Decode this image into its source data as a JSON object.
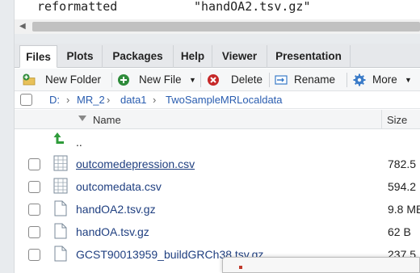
{
  "environment": {
    "row_name": "reformatted",
    "row_value": "\"handOA2.tsv.gz\""
  },
  "tabs": [
    {
      "label": "Files"
    },
    {
      "label": "Plots"
    },
    {
      "label": "Packages"
    },
    {
      "label": "Help"
    },
    {
      "label": "Viewer"
    },
    {
      "label": "Presentation"
    }
  ],
  "toolbar": {
    "new_folder": "New Folder",
    "new_file": "New File",
    "delete": "Delete",
    "rename": "Rename",
    "more": "More"
  },
  "breadcrumb": {
    "items": [
      "D:",
      "MR_2",
      "data1",
      "TwoSampleMRLocaldata"
    ],
    "separator": "›"
  },
  "columns": {
    "name": "Name",
    "size": "Size"
  },
  "files": [
    {
      "name": "..",
      "size": "",
      "icon": "up-arrow-icon"
    },
    {
      "name": "outcomedepression.csv",
      "size": "782.5",
      "icon": "spreadsheet-icon"
    },
    {
      "name": "outcomedata.csv",
      "size": "594.2",
      "icon": "spreadsheet-icon"
    },
    {
      "name": "handOA2.tsv.gz",
      "size": "9.8 MB",
      "icon": "file-icon"
    },
    {
      "name": "handOA.tsv.gz",
      "size": "62 B",
      "icon": "file-icon"
    },
    {
      "name": "GCST90013959_buildGRCh38.tsv.gz",
      "size": "237.5",
      "icon": "file-icon"
    }
  ],
  "colors": {
    "link": "#1f3f80",
    "breadcrumb": "#2a5db0",
    "new_file_green": "#2e8b3a",
    "delete_red": "#c62828",
    "more_blue": "#3a7bc8"
  }
}
